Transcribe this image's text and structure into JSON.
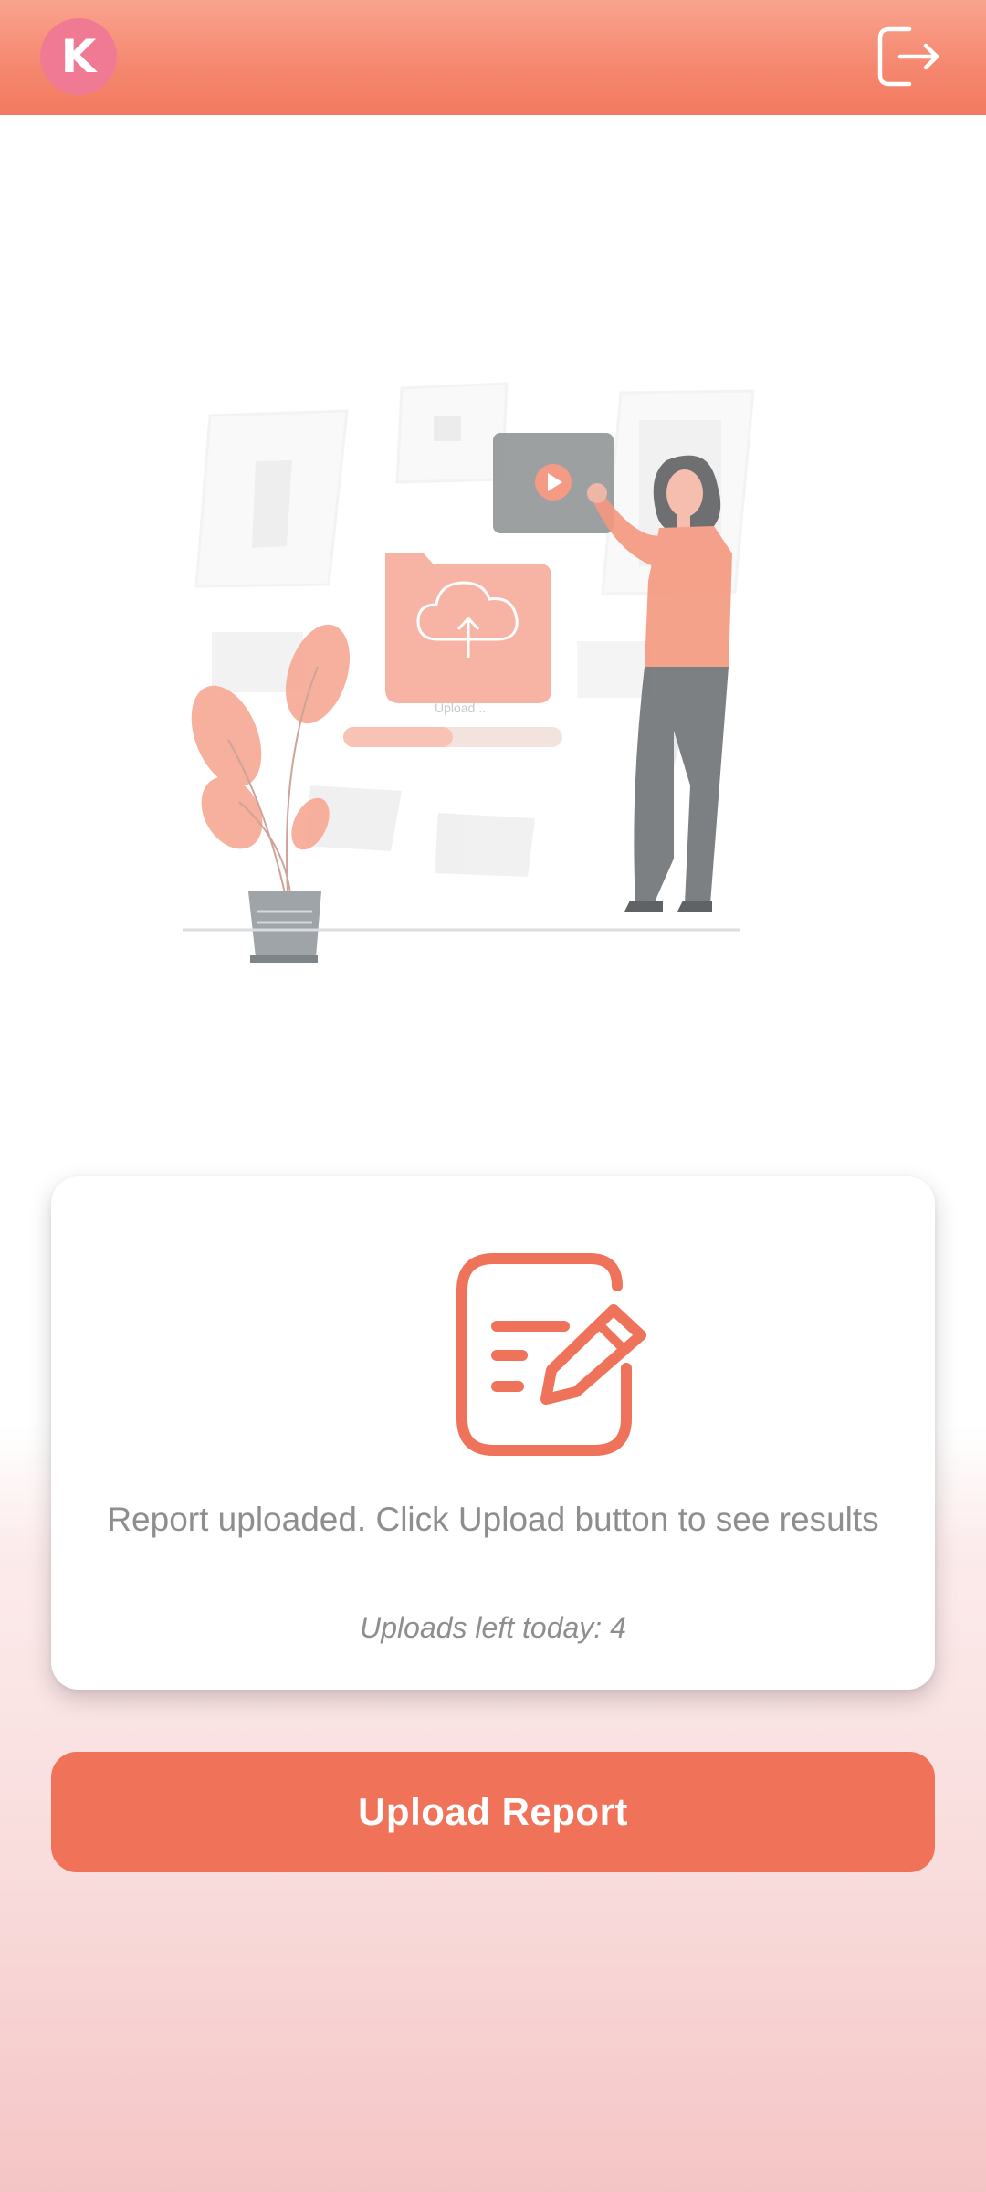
{
  "header": {
    "avatar_initial": "K",
    "logout_icon": "logout-icon"
  },
  "illustration": {
    "icon": "upload-illustration",
    "upload_text": "Upload..."
  },
  "status_card": {
    "icon": "note-edit-icon",
    "message": "Report uploaded. Click Upload button to see results",
    "uploads_left": "Uploads left today: 4"
  },
  "upload_button": {
    "label": "Upload Report"
  },
  "colors": {
    "accent": "#f07258",
    "header_top": "#f9a38e",
    "avatar": "#f07a94"
  }
}
